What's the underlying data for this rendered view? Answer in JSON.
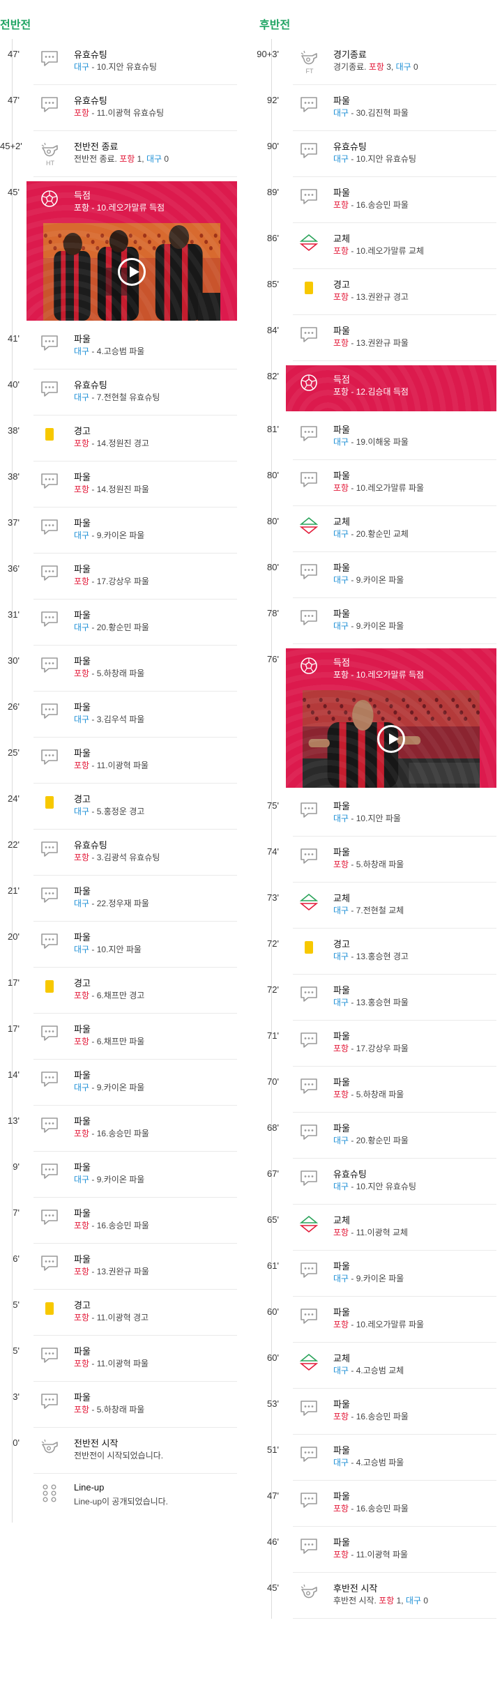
{
  "first_half": {
    "title": "전반전",
    "events": [
      {
        "minute": "47'",
        "type": "shot",
        "title": "유효슈팅",
        "team": "대구",
        "detail": " - 10.지안 유효슈팅",
        "team_class": "daegu"
      },
      {
        "minute": "47'",
        "type": "pass",
        "title": "유효슈팅",
        "team": "포항",
        "detail": " - 11.이광혁 유효슈팅",
        "team_class": "pohang"
      },
      {
        "minute": "45+2'",
        "type": "whistle",
        "title": "전반전 종료",
        "text": "전반전 종료. ",
        "scorer1": "포항",
        "score1": " 1, ",
        "scorer2": "대구",
        "score2": " 0",
        "badge": "HT"
      },
      {
        "minute": "45'",
        "type": "goal-video",
        "title": "득점",
        "team": "포항",
        "detail": " - 10.레오가말류 득점"
      },
      {
        "minute": "41'",
        "type": "pass",
        "title": "파울",
        "team": "대구",
        "detail": " - 4.고승범 파울",
        "team_class": "daegu"
      },
      {
        "minute": "40'",
        "type": "pass",
        "title": "유효슈팅",
        "team": "대구",
        "detail": " - 7.전현철 유효슈팅",
        "team_class": "daegu"
      },
      {
        "minute": "38'",
        "type": "yellow",
        "title": "경고",
        "team": "포항",
        "detail": " - 14.정원진 경고",
        "team_class": "pohang"
      },
      {
        "minute": "38'",
        "type": "pass",
        "title": "파울",
        "team": "포항",
        "detail": " - 14.정원진 파울",
        "team_class": "pohang"
      },
      {
        "minute": "37'",
        "type": "pass",
        "title": "파울",
        "team": "대구",
        "detail": " - 9.카이온 파울",
        "team_class": "daegu"
      },
      {
        "minute": "36'",
        "type": "pass",
        "title": "파울",
        "team": "포항",
        "detail": " - 17.강상우 파울",
        "team_class": "pohang"
      },
      {
        "minute": "31'",
        "type": "pass",
        "title": "파울",
        "team": "대구",
        "detail": " - 20.황순민 파울",
        "team_class": "daegu"
      },
      {
        "minute": "30'",
        "type": "pass",
        "title": "파울",
        "team": "포항",
        "detail": " - 5.하창래 파울",
        "team_class": "pohang"
      },
      {
        "minute": "26'",
        "type": "pass",
        "title": "파울",
        "team": "대구",
        "detail": " - 3.김우석 파울",
        "team_class": "daegu"
      },
      {
        "minute": "25'",
        "type": "pass",
        "title": "파울",
        "team": "포항",
        "detail": " - 11.이광혁 파울",
        "team_class": "pohang"
      },
      {
        "minute": "24'",
        "type": "yellow",
        "title": "경고",
        "team": "대구",
        "detail": " - 5.홍정운 경고",
        "team_class": "daegu"
      },
      {
        "minute": "22'",
        "type": "pass",
        "title": "유효슈팅",
        "team": "포항",
        "detail": " - 3.김광석 유효슈팅",
        "team_class": "pohang"
      },
      {
        "minute": "21'",
        "type": "pass",
        "title": "파울",
        "team": "대구",
        "detail": " - 22.정우재 파울",
        "team_class": "daegu"
      },
      {
        "minute": "20'",
        "type": "pass",
        "title": "파울",
        "team": "대구",
        "detail": " - 10.지안 파울",
        "team_class": "daegu"
      },
      {
        "minute": "17'",
        "type": "yellow",
        "title": "경고",
        "team": "포항",
        "detail": " - 6.채프만 경고",
        "team_class": "pohang"
      },
      {
        "minute": "17'",
        "type": "pass",
        "title": "파울",
        "team": "포항",
        "detail": " - 6.채프만 파울",
        "team_class": "pohang"
      },
      {
        "minute": "14'",
        "type": "pass",
        "title": "파울",
        "team": "대구",
        "detail": " - 9.카이온 파울",
        "team_class": "daegu"
      },
      {
        "minute": "13'",
        "type": "pass",
        "title": "파울",
        "team": "포항",
        "detail": " - 16.송승민 파울",
        "team_class": "pohang"
      },
      {
        "minute": "9'",
        "type": "pass",
        "title": "파울",
        "team": "대구",
        "detail": " - 9.카이온 파울",
        "team_class": "daegu"
      },
      {
        "minute": "7'",
        "type": "pass",
        "title": "파울",
        "team": "포항",
        "detail": " - 16.송승민 파울",
        "team_class": "pohang"
      },
      {
        "minute": "6'",
        "type": "pass",
        "title": "파울",
        "team": "포항",
        "detail": " - 13.권완규 파울",
        "team_class": "pohang"
      },
      {
        "minute": "5'",
        "type": "yellow",
        "title": "경고",
        "team": "포항",
        "detail": " - 11.이광혁 경고",
        "team_class": "pohang"
      },
      {
        "minute": "5'",
        "type": "pass",
        "title": "파울",
        "team": "포항",
        "detail": " - 11.이광혁 파울",
        "team_class": "pohang"
      },
      {
        "minute": "3'",
        "type": "pass",
        "title": "파울",
        "team": "포항",
        "detail": " - 5.하창래 파울",
        "team_class": "pohang"
      },
      {
        "minute": "0'",
        "type": "whistle",
        "title": "전반전 시작",
        "text": "전반전이 시작되었습니다."
      }
    ],
    "lineup": {
      "title": "Line-up",
      "text": "Line-up이 공개되었습니다."
    }
  },
  "second_half": {
    "title": "후반전",
    "events": [
      {
        "minute": "90+3'",
        "type": "whistle",
        "title": "경기종료",
        "text": "경기종료. ",
        "scorer1": "포항",
        "score1": " 3, ",
        "scorer2": "대구",
        "score2": " 0",
        "badge": "FT"
      },
      {
        "minute": "92'",
        "type": "pass",
        "title": "파울",
        "team": "대구",
        "detail": " - 30.김진혁 파울",
        "team_class": "daegu"
      },
      {
        "minute": "90'",
        "type": "pass",
        "title": "유효슈팅",
        "team": "대구",
        "detail": " - 10.지안 유효슈팅",
        "team_class": "daegu"
      },
      {
        "minute": "89'",
        "type": "pass",
        "title": "파울",
        "team": "포항",
        "detail": " - 16.송승민 파울",
        "team_class": "pohang"
      },
      {
        "minute": "86'",
        "type": "sub",
        "title": "교체",
        "team": "포항",
        "detail": " - 10.레오가말류 교체",
        "team_class": "pohang"
      },
      {
        "minute": "85'",
        "type": "yellow",
        "title": "경고",
        "team": "포항",
        "detail": " - 13.권완규 경고",
        "team_class": "pohang"
      },
      {
        "minute": "84'",
        "type": "pass",
        "title": "파울",
        "team": "포항",
        "detail": " - 13.권완규 파울",
        "team_class": "pohang"
      },
      {
        "minute": "82'",
        "type": "goal",
        "title": "득점",
        "team": "포항",
        "detail": " - 12.김승대 득점"
      },
      {
        "minute": "81'",
        "type": "pass",
        "title": "파울",
        "team": "대구",
        "detail": " - 19.이해웅 파울",
        "team_class": "daegu"
      },
      {
        "minute": "80'",
        "type": "pass",
        "title": "파울",
        "team": "포항",
        "detail": " - 10.레오가말류 파울",
        "team_class": "pohang"
      },
      {
        "minute": "80'",
        "type": "sub",
        "title": "교체",
        "team": "대구",
        "detail": " - 20.황순민 교체",
        "team_class": "daegu"
      },
      {
        "minute": "80'",
        "type": "pass",
        "title": "파울",
        "team": "대구",
        "detail": " - 9.카이온 파울",
        "team_class": "daegu"
      },
      {
        "minute": "78'",
        "type": "pass",
        "title": "파울",
        "team": "대구",
        "detail": " - 9.카이온 파울",
        "team_class": "daegu"
      },
      {
        "minute": "76'",
        "type": "goal-video",
        "title": "득점",
        "team": "포항",
        "detail": " - 10.레오가말류 득점"
      },
      {
        "minute": "75'",
        "type": "pass",
        "title": "파울",
        "team": "대구",
        "detail": " - 10.지안 파울",
        "team_class": "daegu"
      },
      {
        "minute": "74'",
        "type": "pass",
        "title": "파울",
        "team": "포항",
        "detail": " - 5.하창래 파울",
        "team_class": "pohang"
      },
      {
        "minute": "73'",
        "type": "sub",
        "title": "교체",
        "team": "대구",
        "detail": " - 7.전현철 교체",
        "team_class": "daegu"
      },
      {
        "minute": "72'",
        "type": "yellow",
        "title": "경고",
        "team": "대구",
        "detail": " - 13.홍승현 경고",
        "team_class": "daegu"
      },
      {
        "minute": "72'",
        "type": "pass",
        "title": "파울",
        "team": "대구",
        "detail": " - 13.홍승현 파울",
        "team_class": "daegu"
      },
      {
        "minute": "71'",
        "type": "pass",
        "title": "파울",
        "team": "포항",
        "detail": " - 17.강상우 파울",
        "team_class": "pohang"
      },
      {
        "minute": "70'",
        "type": "pass",
        "title": "파울",
        "team": "포항",
        "detail": " - 5.하창래 파울",
        "team_class": "pohang"
      },
      {
        "minute": "68'",
        "type": "pass",
        "title": "파울",
        "team": "대구",
        "detail": " - 20.황순민 파울",
        "team_class": "daegu"
      },
      {
        "minute": "67'",
        "type": "pass",
        "title": "유효슈팅",
        "team": "대구",
        "detail": " - 10.지안 유효슈팅",
        "team_class": "daegu"
      },
      {
        "minute": "65'",
        "type": "sub",
        "title": "교체",
        "team": "포항",
        "detail": " - 11.이광혁 교체",
        "team_class": "pohang"
      },
      {
        "minute": "61'",
        "type": "pass",
        "title": "파울",
        "team": "대구",
        "detail": " - 9.카이온 파울",
        "team_class": "daegu"
      },
      {
        "minute": "60'",
        "type": "pass",
        "title": "파울",
        "team": "포항",
        "detail": " - 10.레오가말류 파울",
        "team_class": "pohang"
      },
      {
        "minute": "60'",
        "type": "sub",
        "title": "교체",
        "team": "대구",
        "detail": " - 4.고승범 교체",
        "team_class": "daegu"
      },
      {
        "minute": "53'",
        "type": "pass",
        "title": "파울",
        "team": "포항",
        "detail": " - 16.송승민 파울",
        "team_class": "pohang"
      },
      {
        "minute": "51'",
        "type": "pass",
        "title": "파울",
        "team": "대구",
        "detail": " - 4.고승범 파울",
        "team_class": "daegu"
      },
      {
        "minute": "47'",
        "type": "pass",
        "title": "파울",
        "team": "포항",
        "detail": " - 16.송승민 파울",
        "team_class": "pohang"
      },
      {
        "minute": "46'",
        "type": "pass",
        "title": "파울",
        "team": "포항",
        "detail": " - 11.이광혁 파울",
        "team_class": "pohang"
      },
      {
        "minute": "45'",
        "type": "whistle",
        "title": "후반전 시작",
        "text": "후반전 시작. ",
        "scorer1": "포항",
        "score1": " 1, ",
        "scorer2": "대구",
        "score2": " 0"
      }
    ]
  },
  "colors": {
    "pohang": "#e31b3a",
    "daegu": "#1d8fd6",
    "accent": "#1fa463",
    "goal_bg": "#dc1a4d",
    "yellow_card": "#f7c800"
  },
  "icons": {
    "pass": "speech-bubble-icon",
    "shot": "speech-bubble-icon",
    "whistle": "whistle-icon",
    "goal": "soccer-ball-icon",
    "yellow": "yellow-card-icon",
    "sub": "substitution-icon",
    "lineup": "lineup-dots-icon",
    "video": "play-icon"
  }
}
